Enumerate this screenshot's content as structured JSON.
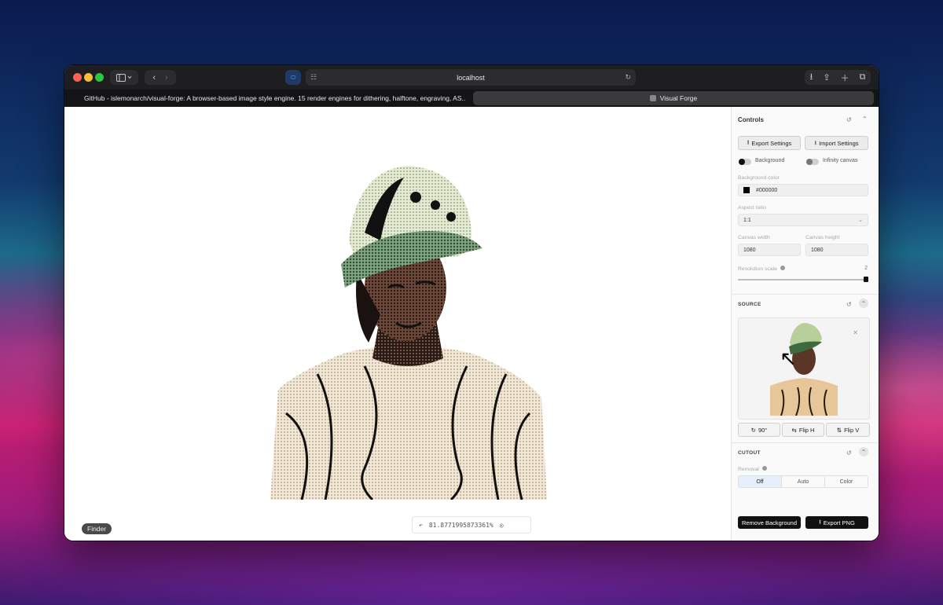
{
  "browser": {
    "address": "localhost",
    "tabs": [
      {
        "label": "GitHub - islemonarch/visual-forge: A browser-based image style engine. 15 render engines for dithering, halftone, engraving, AS..."
      },
      {
        "label": "Visual Forge"
      }
    ]
  },
  "canvas": {
    "zoom_readout": "81.8771995873361%",
    "tooltip": "Finder"
  },
  "panel": {
    "title": "Controls",
    "export_settings": "Export Settings",
    "import_settings": "Import Settings",
    "background_toggle": "Background",
    "infinity_toggle": "Infinity canvas",
    "background_color_label": "Background color",
    "background_color_value": "#000000",
    "aspect_ratio_label": "Aspect ratio",
    "aspect_ratio_value": "1:1",
    "canvas_width_label": "Canvas width",
    "canvas_width_value": "1080",
    "canvas_height_label": "Canvas height",
    "canvas_height_value": "1080",
    "resolution_label": "Resolution scale",
    "resolution_value": "2",
    "resolution_fraction": 1.0,
    "source_header": "SOURCE",
    "rotate_label": "90°",
    "flip_h_label": "Flip H",
    "flip_v_label": "Flip V",
    "cutout_header": "CUTOUT",
    "removal_label": "Removal",
    "removal_options": [
      "Off",
      "Auto",
      "Color"
    ],
    "removal_selected": "Off",
    "remove_bg_button": "Remove Background",
    "export_png_button": "Export PNG"
  },
  "colors": {
    "accent": "#111111",
    "selected_segment": "#e6f0fb"
  }
}
